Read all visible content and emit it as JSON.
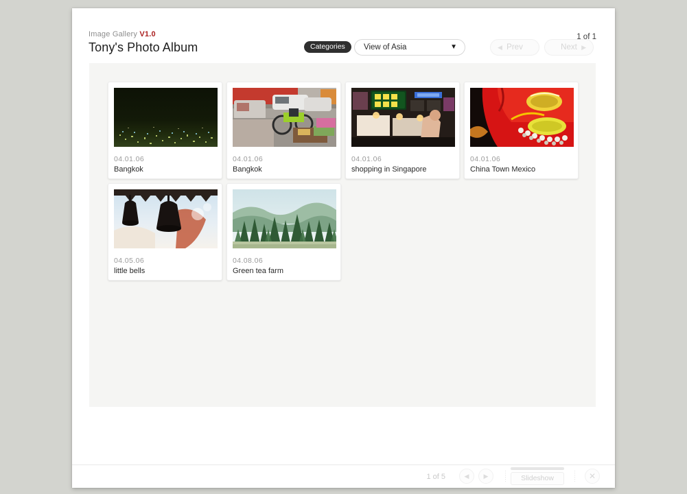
{
  "app": {
    "brand_name": "Image Gallery",
    "version": "V1.0",
    "album_title": "Tony's Photo Album",
    "accent_color": "#ab2121"
  },
  "header": {
    "categories_label": "Categories",
    "selected_category": "View of Asia",
    "dropdown_caret": "chevron-down-icon",
    "prev_label": "Prev",
    "next_label": "Next",
    "prev_arrow": "◀",
    "next_arrow": "▶",
    "page_counter": "1 of 1"
  },
  "gallery": {
    "photos": [
      {
        "date": "04.01.06",
        "caption": "Bangkok",
        "alt": "bangkok-night-skyline"
      },
      {
        "date": "04.01.06",
        "caption": "Bangkok",
        "alt": "bangkok-street-traffic"
      },
      {
        "date": "04.01.06",
        "caption": "shopping in Singapore",
        "alt": "singapore-night-market-signs"
      },
      {
        "date": "04.01.06",
        "caption": "China Town Mexico",
        "alt": "red-lion-dance-head"
      },
      {
        "date": "04.05.06",
        "caption": "little bells",
        "alt": "temple-bells-silhouette"
      },
      {
        "date": "04.08.06",
        "caption": "Green tea farm",
        "alt": "green-forest-hillside"
      }
    ]
  },
  "footer": {
    "counter": "1 of 5",
    "prev_arrow": "◀",
    "next_arrow": "▶",
    "slideshow_label": "Slideshow",
    "close_icon": "✕",
    "progress_percent": 100
  }
}
